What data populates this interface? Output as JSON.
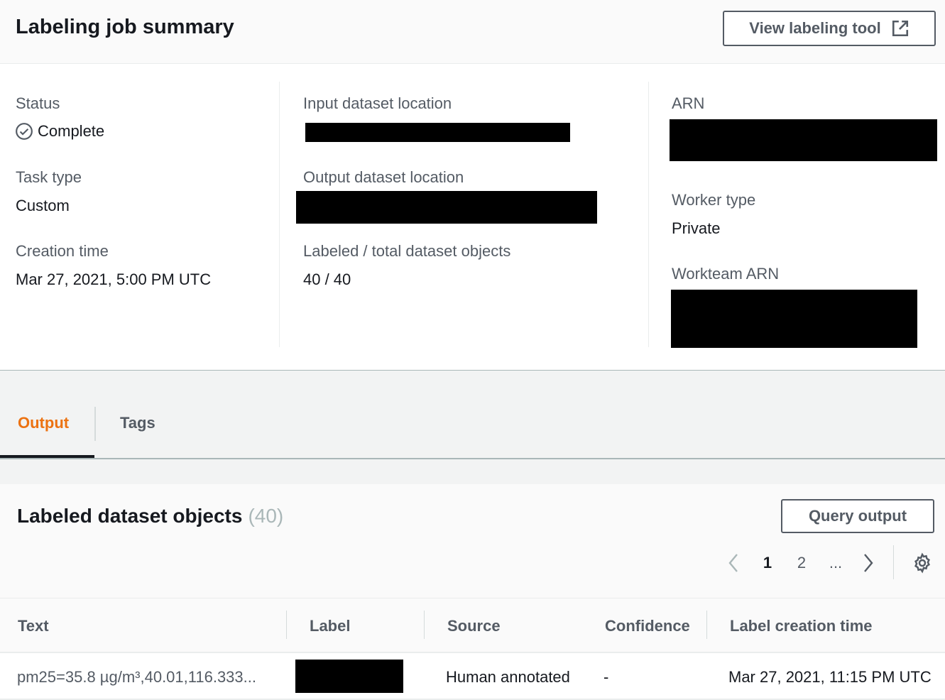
{
  "summary": {
    "title": "Labeling job summary",
    "view_tool_label": "View labeling tool",
    "fields": {
      "status_label": "Status",
      "status_value": "Complete",
      "task_type_label": "Task type",
      "task_type_value": "Custom",
      "creation_time_label": "Creation time",
      "creation_time_value": "Mar 27, 2021, 5:00 PM UTC",
      "input_location_label": "Input dataset location",
      "output_location_label": "Output dataset location",
      "labeled_total_label": "Labeled / total dataset objects",
      "labeled_total_value": "40 / 40",
      "arn_label": "ARN",
      "worker_type_label": "Worker type",
      "worker_type_value": "Private",
      "workteam_arn_label": "Workteam ARN"
    }
  },
  "tabs": [
    {
      "label": "Output",
      "active": true
    },
    {
      "label": "Tags",
      "active": false
    }
  ],
  "objects": {
    "title": "Labeled dataset objects",
    "count": "(40)",
    "query_label": "Query output",
    "pagination": {
      "prev": "‹",
      "pages": [
        "1",
        "2"
      ],
      "ellipsis": "...",
      "next": "›",
      "current": "1"
    },
    "columns": [
      "Text",
      "Label",
      "Source",
      "Confidence",
      "Label creation time"
    ],
    "rows": [
      {
        "text": "pm25=35.8 µg/m³,40.01,116.333...",
        "source": "Human annotated",
        "confidence": "-",
        "creation_time": "Mar 27, 2021, 11:15 PM UTC"
      }
    ]
  },
  "icons": {
    "external_link": "external-link-icon",
    "status": "check-circle-icon",
    "settings": "gear-icon"
  },
  "colors": {
    "accent": "#ec7211",
    "text": "#16191f",
    "muted": "#545b64",
    "divider": "#eaeded"
  }
}
